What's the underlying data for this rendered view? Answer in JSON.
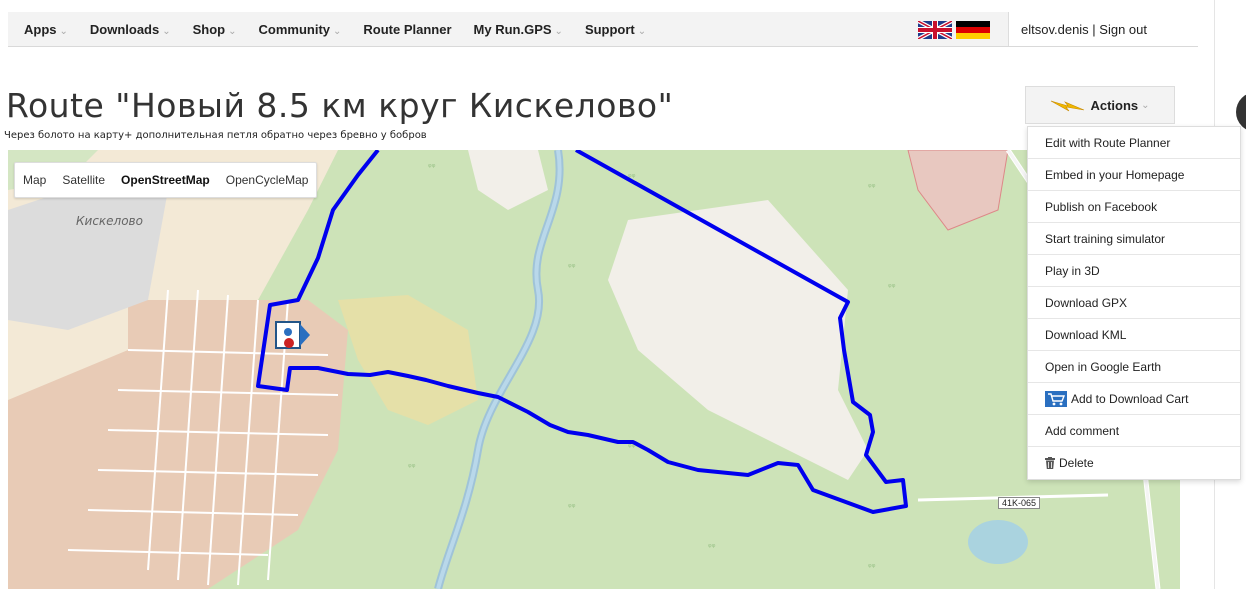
{
  "nav": {
    "items": [
      {
        "label": "Apps",
        "has_dropdown": true
      },
      {
        "label": "Downloads",
        "has_dropdown": true
      },
      {
        "label": "Shop",
        "has_dropdown": true
      },
      {
        "label": "Community",
        "has_dropdown": true
      },
      {
        "label": "Route Planner",
        "has_dropdown": false
      },
      {
        "label": "My Run.GPS",
        "has_dropdown": true
      },
      {
        "label": "Support",
        "has_dropdown": true
      }
    ],
    "caret": "⌄"
  },
  "flags": [
    "uk-flag-icon",
    "germany-flag-icon"
  ],
  "user": {
    "text": "eltsov.denis | Sign out"
  },
  "page": {
    "title": "Route \"Новый 8.5 км круг Кискелово\"",
    "subtitle": "Через болото на карту+ дополнительная петля обратно через бревно у бобров"
  },
  "map": {
    "tabs": [
      "Map",
      "Satellite",
      "OpenStreetMap",
      "OpenCycleMap"
    ],
    "active_tab": "OpenStreetMap",
    "town_label": "Кискелово",
    "road_sign": "41K-065",
    "route_color": "#0000ee"
  },
  "actions": {
    "label": "Actions",
    "caret": "⌄",
    "menu": [
      {
        "label": "Edit with Route Planner",
        "icon": ""
      },
      {
        "label": "Embed in your Homepage",
        "icon": ""
      },
      {
        "label": "Publish on Facebook",
        "icon": ""
      },
      {
        "label": "Start training simulator",
        "icon": ""
      },
      {
        "label": "Play in 3D",
        "icon": ""
      },
      {
        "label": "Download GPX",
        "icon": ""
      },
      {
        "label": "Download KML",
        "icon": ""
      },
      {
        "label": "Open in Google Earth",
        "icon": ""
      },
      {
        "label": "Add to Download Cart",
        "icon": "cart-icon"
      },
      {
        "label": "Add comment",
        "icon": ""
      },
      {
        "label": "Delete",
        "icon": "trash-icon"
      }
    ]
  }
}
